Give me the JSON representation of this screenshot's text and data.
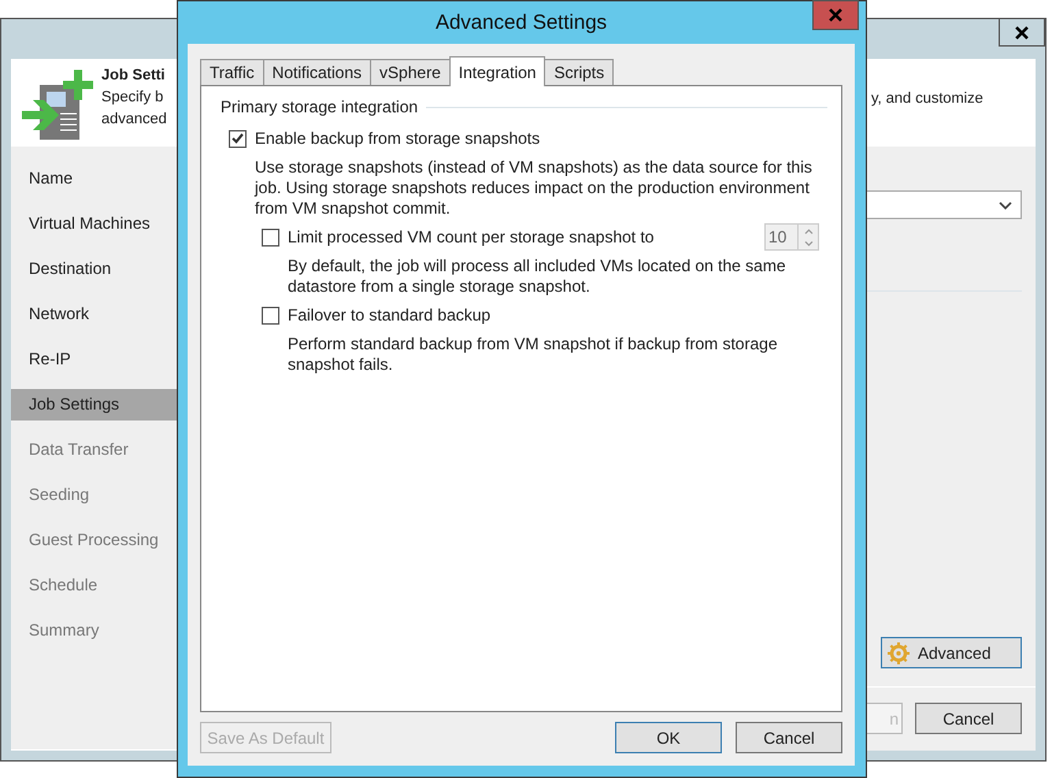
{
  "background_window": {
    "header": {
      "title": "Job Setti",
      "description_left": [
        "Specify b",
        "advanced"
      ],
      "description_right": "y, and customize"
    },
    "steps": [
      {
        "label": "Name",
        "selected": false,
        "enabled": true
      },
      {
        "label": "Virtual Machines",
        "selected": false,
        "enabled": true
      },
      {
        "label": "Destination",
        "selected": false,
        "enabled": true
      },
      {
        "label": "Network",
        "selected": false,
        "enabled": true
      },
      {
        "label": "Re-IP",
        "selected": false,
        "enabled": true
      },
      {
        "label": "Job Settings",
        "selected": true,
        "enabled": true
      },
      {
        "label": "Data Transfer",
        "selected": false,
        "enabled": false
      },
      {
        "label": "Seeding",
        "selected": false,
        "enabled": false
      },
      {
        "label": "Guest Processing",
        "selected": false,
        "enabled": false
      },
      {
        "label": "Schedule",
        "selected": false,
        "enabled": false
      },
      {
        "label": "Summary",
        "selected": false,
        "enabled": false
      }
    ],
    "advanced_button": "Advanced",
    "partial_button": "n",
    "cancel_button": "Cancel"
  },
  "dialog": {
    "title": "Advanced Settings",
    "tabs": [
      {
        "label": "Traffic",
        "selected": false
      },
      {
        "label": "Notifications",
        "selected": false
      },
      {
        "label": "vSphere",
        "selected": false
      },
      {
        "label": "Integration",
        "selected": true
      },
      {
        "label": "Scripts",
        "selected": false
      }
    ],
    "group_title": "Primary storage integration",
    "options": [
      {
        "label": "Enable backup from storage snapshots",
        "checked": true,
        "description": "Use storage snapshots (instead of VM snapshots) as the data source for this job. Using storage snapshots reduces impact on the production environment from VM snapshot commit.",
        "children": [
          {
            "label": "Limit processed VM count per storage snapshot to",
            "checked": false,
            "spinner": "10",
            "description": "By default, the job will process all included VMs located on the same datastore from a single storage snapshot."
          },
          {
            "label": "Failover to standard backup",
            "checked": false,
            "description": "Perform standard backup from VM snapshot if backup from storage snapshot fails."
          }
        ]
      }
    ],
    "save_default_button": {
      "label": "Save As Default",
      "disabled": true
    },
    "ok_button": "OK",
    "cancel_button": "Cancel"
  }
}
